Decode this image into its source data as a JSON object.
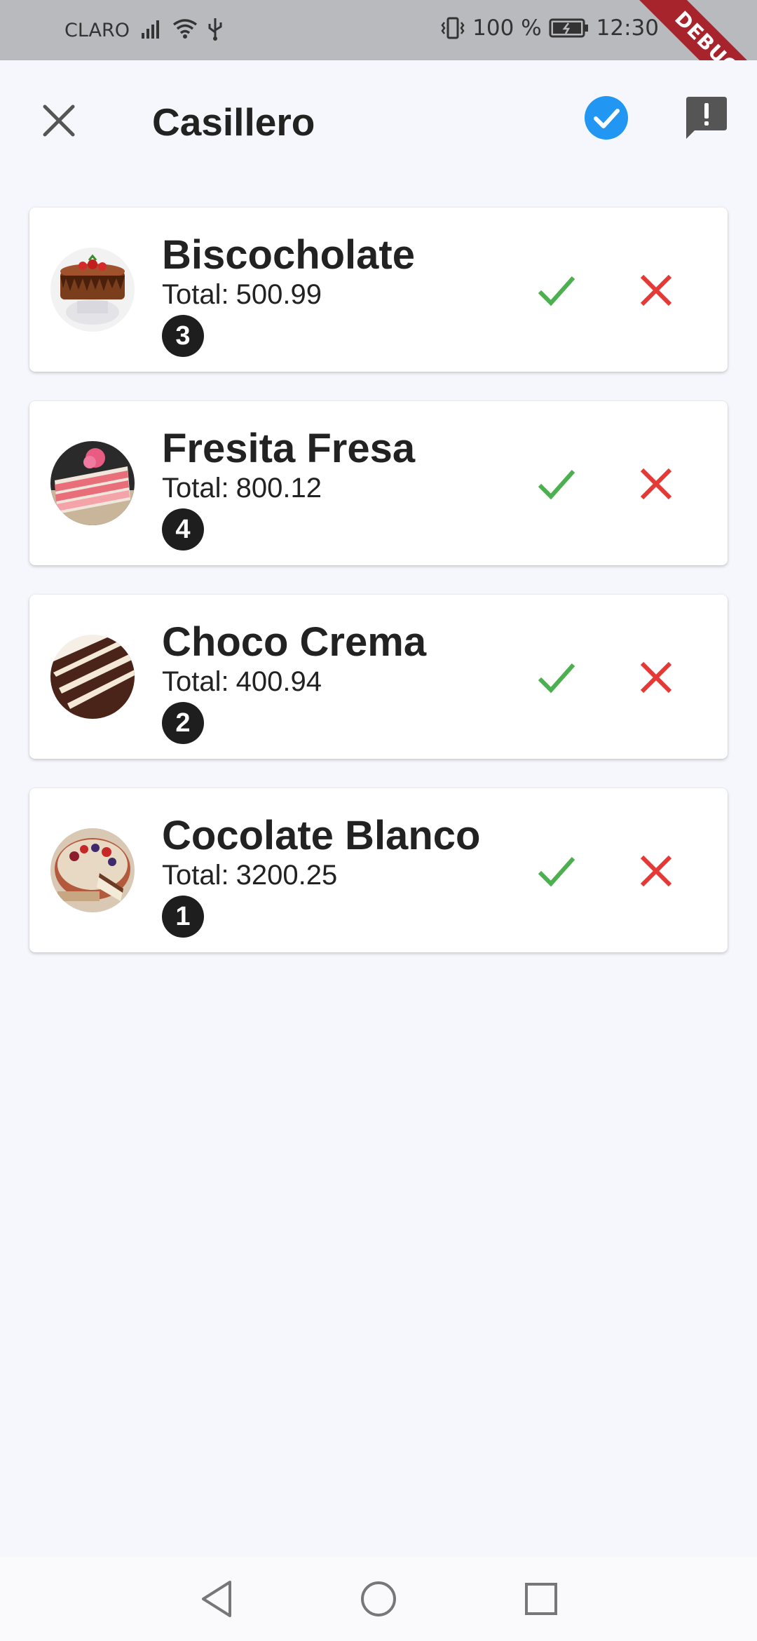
{
  "status_bar": {
    "carrier": "CLARO",
    "battery": "100 %",
    "time": "12:30",
    "debug_banner": "DEBUG"
  },
  "app_bar": {
    "title": "Casillero",
    "close_icon": "close-icon",
    "confirm_icon": "check-circle-icon",
    "report_icon": "report-icon"
  },
  "total_label": "Total:",
  "items": [
    {
      "name": "Biscocholate",
      "total": "500.99",
      "quantity": "3"
    },
    {
      "name": "Fresita Fresa",
      "total": "800.12",
      "quantity": "4"
    },
    {
      "name": "Choco Crema",
      "total": "400.94",
      "quantity": "2"
    },
    {
      "name": "Cocolate Blanco",
      "total": "3200.25",
      "quantity": "1"
    }
  ],
  "colors": {
    "accept": "#4caf50",
    "reject": "#e53935",
    "confirm": "#2196f3",
    "background": "#f6f7fc"
  }
}
